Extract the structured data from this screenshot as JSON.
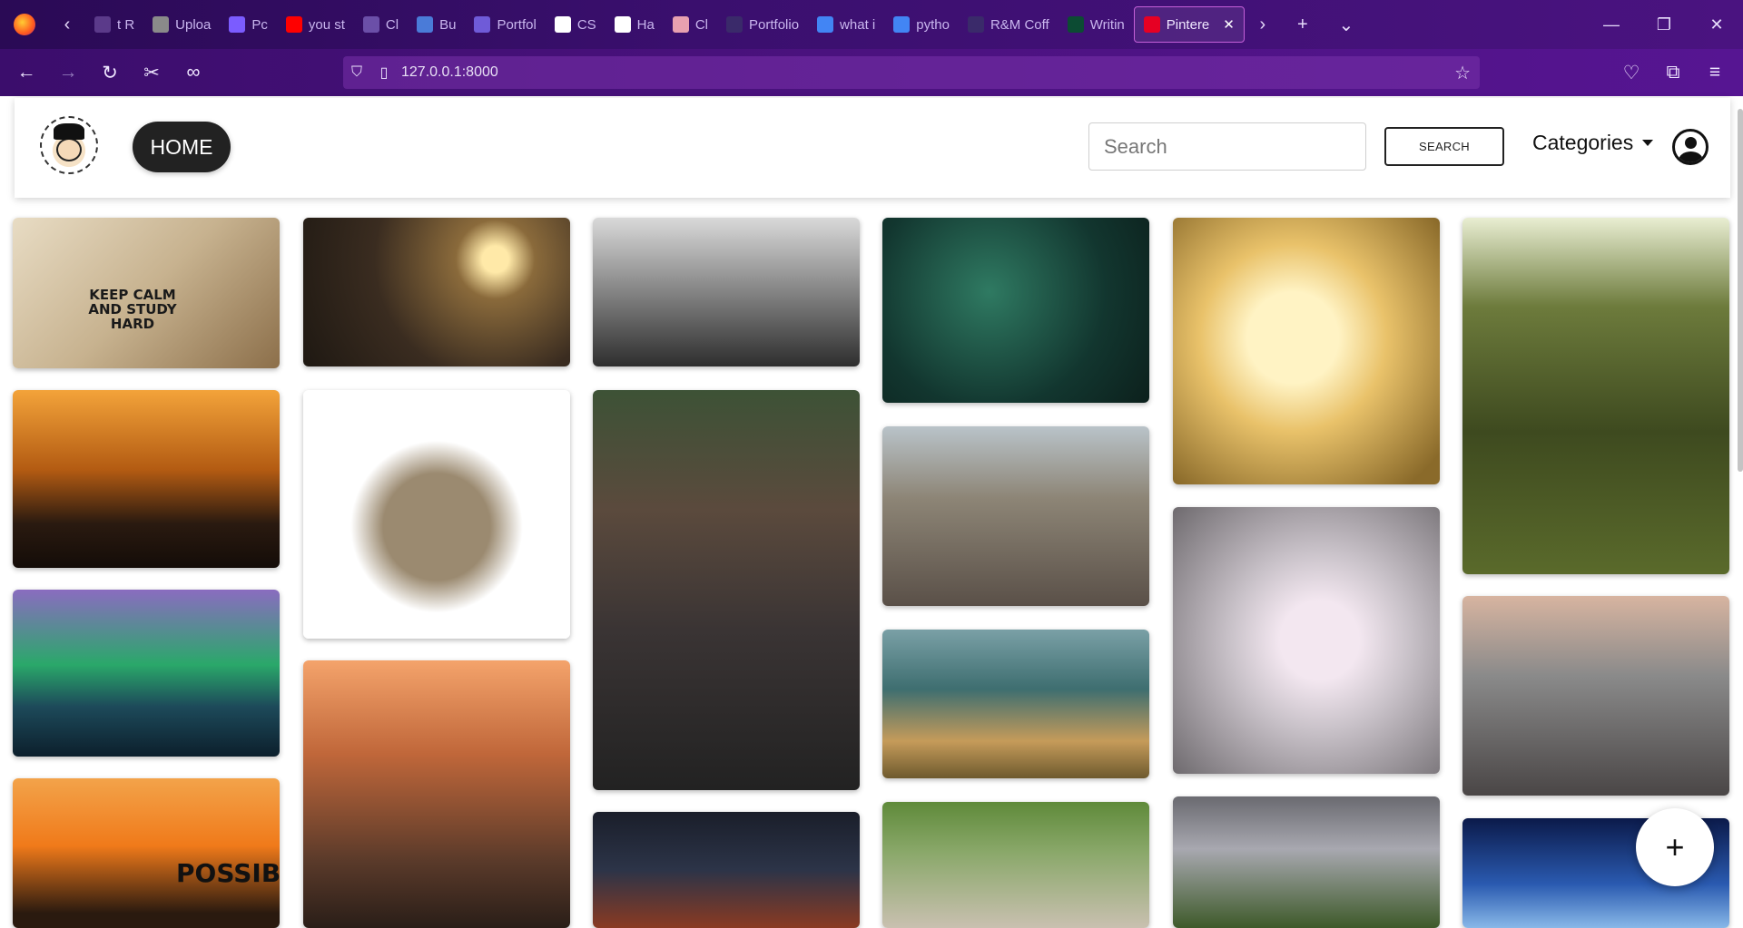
{
  "browser": {
    "tabs": [
      {
        "label": "t R",
        "color": "#5b3a8a"
      },
      {
        "label": "Uploa",
        "color": "#8a8a8a"
      },
      {
        "label": "Pc",
        "color": "#7b5cff"
      },
      {
        "label": "you st",
        "color": "#ff0000"
      },
      {
        "label": "Cl",
        "color": "#6b4fa8"
      },
      {
        "label": "Bu",
        "color": "#4a7bd8"
      },
      {
        "label": "Portfol",
        "color": "#6f5bd8"
      },
      {
        "label": "CS",
        "color": "#ffffff"
      },
      {
        "label": "Ha",
        "color": "#ffffff"
      },
      {
        "label": "Cl",
        "color": "#e8a0b0"
      },
      {
        "label": "Portfolio",
        "color": "#3a2a6a"
      },
      {
        "label": "what i",
        "color": "#4285f4"
      },
      {
        "label": "pytho",
        "color": "#4285f4"
      },
      {
        "label": "R&M Coff",
        "color": "#3a2a6a"
      },
      {
        "label": "Writin",
        "color": "#0c4b33"
      },
      {
        "label": "Pintere",
        "color": "#e60023"
      }
    ],
    "url": "127.0.0.1:8000"
  },
  "header": {
    "home_label": "HOME",
    "search_placeholder": "Search",
    "search_button": "SEARCH",
    "categories_label": "Categories"
  },
  "tiles": {
    "keep_calm_text": "KEEP CALM AND STUDY HARD",
    "possible_text": "POSSIBLE"
  },
  "fab": {
    "label": "+"
  },
  "colors": {
    "accent_dark": "#222222",
    "browser_purple": "#3a0f6e"
  }
}
